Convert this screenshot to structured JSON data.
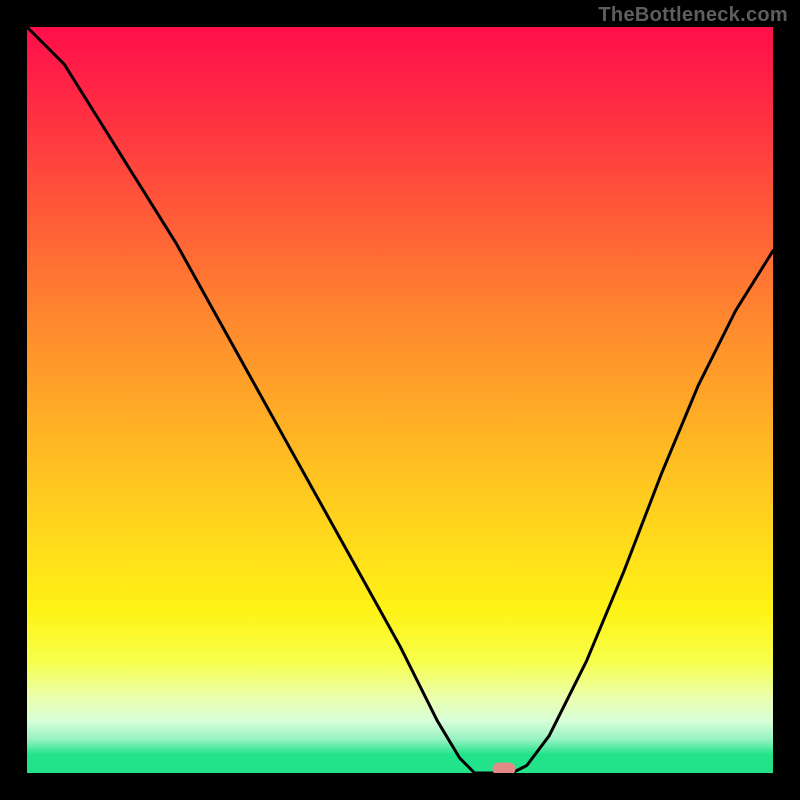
{
  "watermark": "TheBottleneck.com",
  "chart_data": {
    "type": "line",
    "title": "",
    "xlabel": "",
    "ylabel": "",
    "xlim": [
      0,
      100
    ],
    "ylim": [
      0,
      100
    ],
    "x": [
      0,
      5,
      10,
      15,
      20,
      25,
      30,
      35,
      40,
      45,
      50,
      55,
      58,
      60,
      63,
      65,
      67,
      70,
      75,
      80,
      85,
      90,
      95,
      100
    ],
    "values": [
      103,
      95,
      87,
      79,
      71,
      62,
      53,
      44,
      35,
      26,
      17,
      7,
      2,
      0,
      0,
      0,
      1,
      5,
      15,
      27,
      40,
      52,
      62,
      70
    ],
    "gradient_stops": [
      {
        "pos": 0.0,
        "color": "#ff0e4a"
      },
      {
        "pos": 0.1,
        "color": "#ff2a44"
      },
      {
        "pos": 0.25,
        "color": "#ff5a38"
      },
      {
        "pos": 0.4,
        "color": "#ff8a2e"
      },
      {
        "pos": 0.55,
        "color": "#ffb524"
      },
      {
        "pos": 0.68,
        "color": "#ffd81c"
      },
      {
        "pos": 0.78,
        "color": "#fff215"
      },
      {
        "pos": 0.85,
        "color": "#f7ff4a"
      },
      {
        "pos": 0.9,
        "color": "#eaffb0"
      },
      {
        "pos": 0.93,
        "color": "#d8ffd8"
      },
      {
        "pos": 0.955,
        "color": "#96f2c2"
      },
      {
        "pos": 0.975,
        "color": "#22e38a"
      },
      {
        "pos": 1.0,
        "color": "#22e38a"
      }
    ],
    "marker": {
      "x": 64,
      "y": 0.5,
      "color": "#e28b85"
    }
  }
}
